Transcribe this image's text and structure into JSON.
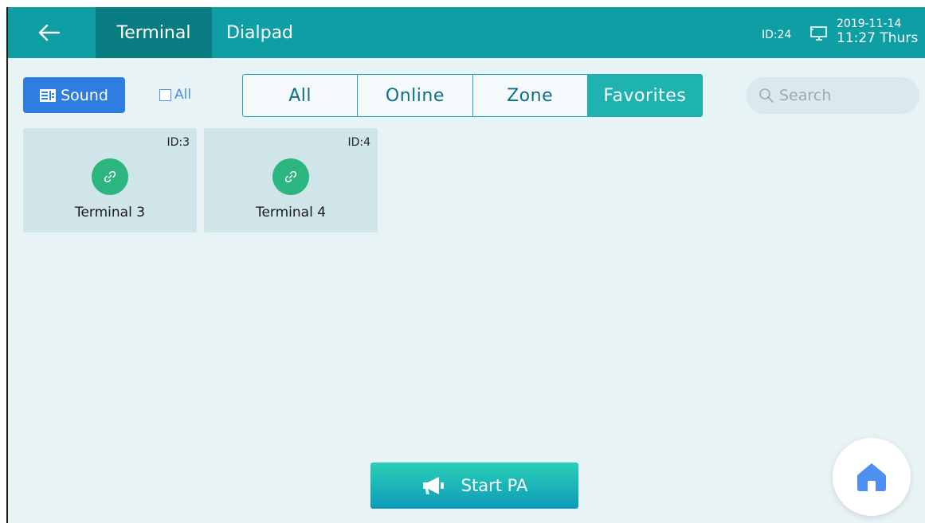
{
  "header": {
    "back_icon": "arrow-left-icon",
    "tabs": [
      {
        "label": "Terminal",
        "active": true
      },
      {
        "label": "Dialpad",
        "active": false
      }
    ],
    "device_id": "ID:24",
    "device_icon": "monitor-icon",
    "date": "2019-11-14",
    "time": "11:27 Thurs"
  },
  "toolbar": {
    "sound_label": "Sound",
    "all_checkbox_label": "All",
    "all_checked": false,
    "filters": [
      {
        "label": "All",
        "active": false
      },
      {
        "label": "Online",
        "active": false
      },
      {
        "label": "Zone",
        "active": false
      },
      {
        "label": "Favorites",
        "active": true
      }
    ],
    "search_placeholder": "Search"
  },
  "terminals": [
    {
      "id_label": "ID:3",
      "name": "Terminal 3",
      "status_icon": "link-icon"
    },
    {
      "id_label": "ID:4",
      "name": "Terminal 4",
      "status_icon": "link-icon"
    }
  ],
  "footer": {
    "start_pa_label": "Start PA",
    "start_pa_icon": "megaphone-icon",
    "home_icon": "home-icon"
  },
  "colors": {
    "header_bg": "#0e9ea4",
    "active_tab_bg": "#097c81",
    "active_filter_bg": "#1fb3b0",
    "sound_button_bg": "#2f7de0",
    "online_green": "#2cb57f",
    "home_blue": "#4f8ff0"
  }
}
